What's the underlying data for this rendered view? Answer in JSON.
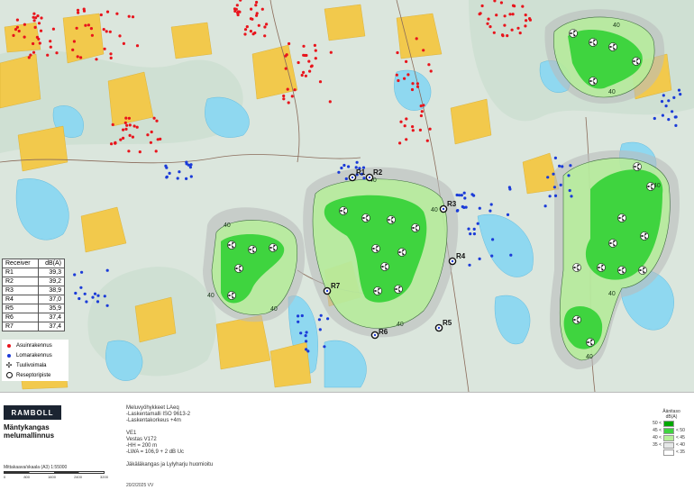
{
  "map": {
    "receivers": [
      {
        "id": "R1"
      },
      {
        "id": "R2"
      },
      {
        "id": "R3"
      },
      {
        "id": "R4"
      },
      {
        "id": "R5"
      },
      {
        "id": "R6"
      },
      {
        "id": "R7"
      }
    ],
    "contour_label": "40",
    "colors": {
      "zone_50": "#00a800",
      "zone_45": "#3fd43f",
      "zone_40": "#b6ef9a",
      "zone_35": "#b9bdbd",
      "water": "#7fd3ee",
      "fields": "#f2c94c",
      "residential": "#e8141c",
      "holiday": "#1b3bd8"
    }
  },
  "receiver_table": {
    "header_receiver": "Receiver",
    "header_db": "dB(A)",
    "rows": [
      {
        "id": "R1",
        "value": "39,3"
      },
      {
        "id": "R2",
        "value": "39,2"
      },
      {
        "id": "R3",
        "value": "38,9"
      },
      {
        "id": "R4",
        "value": "37,0"
      },
      {
        "id": "R5",
        "value": "35,9"
      },
      {
        "id": "R6",
        "value": "37,4"
      },
      {
        "id": "R7",
        "value": "37,4"
      }
    ]
  },
  "symbol_legend": {
    "residential": "Asuinrakennus",
    "holiday": "Lomarakennus",
    "turbine": "Tuulivoimala",
    "receiver": "Reseptoripiste"
  },
  "footer": {
    "logo": "RAMBOLL",
    "title_line1": "Mäntykangas",
    "title_line2": "melumallinnus",
    "scale": "Mittakaava/skaala (A3) 1:55000",
    "scale_ticks": [
      "0",
      "800",
      "1600",
      "2400",
      "3200"
    ],
    "info_lines": [
      "Meluvyöhykkeet LAeq",
      "-Laskentamalli ISO 9613-2",
      "-Laskentakorkeus +4m",
      "",
      "VE1",
      "Vestas V172",
      "-HH = 200 m",
      "-LWA = 106,9 + 2 dB Uc",
      "",
      "Jäkäläkangas ja Lylyharju huomioitu"
    ],
    "date": "20/2/2025 VV"
  },
  "noise_legend": {
    "title_line1": "Äänitaso",
    "title_line2": "dB(A)",
    "rows": [
      {
        "low": "50 <",
        "high": "",
        "color": "#00a800"
      },
      {
        "low": "45 <",
        "high": "< 50",
        "color": "#3fd43f"
      },
      {
        "low": "40 <",
        "high": "< 45",
        "color": "#b6ef9a"
      },
      {
        "low": "35 <",
        "high": "< 40",
        "color": "#e6e8e8"
      },
      {
        "low": "",
        "high": "< 35",
        "color": "#ffffff"
      }
    ]
  }
}
